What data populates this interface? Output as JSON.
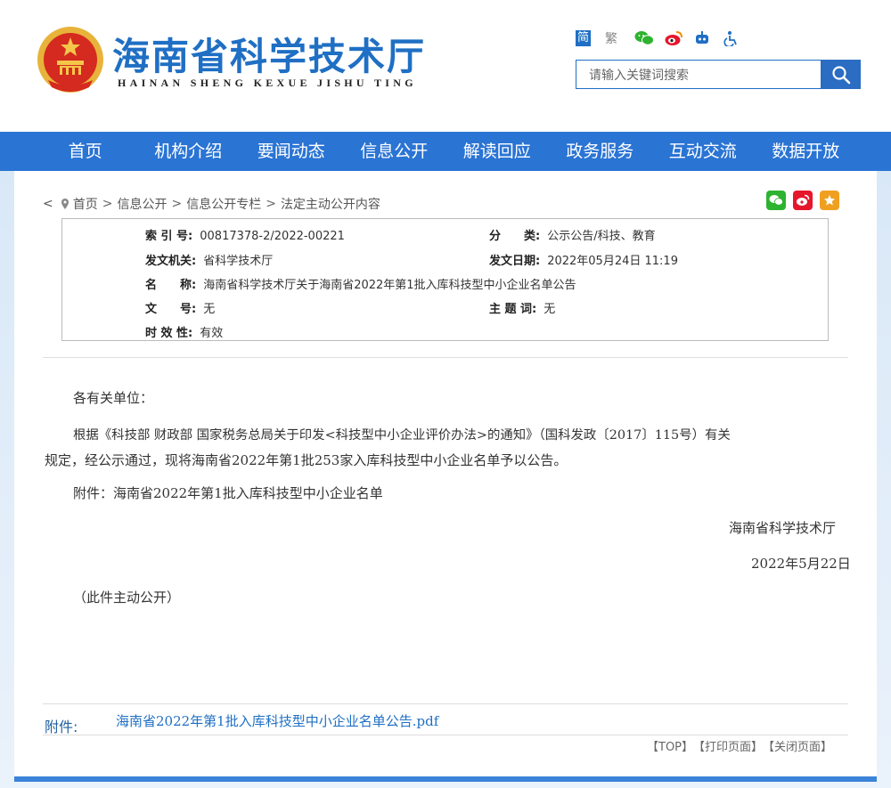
{
  "site": {
    "title": "海南省科学技术厅",
    "pinyin": "HAINAN SHENG KEXUE JISHU TING"
  },
  "tools": {
    "simplified": "简",
    "traditional": "繁"
  },
  "search": {
    "placeholder": "请输入关键词搜索"
  },
  "nav": [
    {
      "label": "首页"
    },
    {
      "label": "机构介绍"
    },
    {
      "label": "要闻动态"
    },
    {
      "label": "信息公开"
    },
    {
      "label": "解读回应"
    },
    {
      "label": "政务服务"
    },
    {
      "label": "互动交流"
    },
    {
      "label": "数据开放"
    }
  ],
  "breadcrumb": {
    "back": "<",
    "items": [
      "首页",
      "信息公开",
      "信息公开专栏",
      "法定主动公开内容"
    ],
    "sep": ">"
  },
  "info": {
    "index_label": "索 引 号:",
    "index_value": "00817378-2/2022-00221",
    "category_label": "分　　类:",
    "category_value": "公示公告/科技、教育",
    "issuer_label": "发文机关:",
    "issuer_value": "省科学技术厅",
    "date_label": "发文日期:",
    "date_value": "2022年05月24日 11:19",
    "name_label": "名　　称:",
    "name_value": "海南省科学技术厅关于海南省2022年第1批入库科技型中小企业名单公告",
    "docno_label": "文　　号:",
    "docno_value": "无",
    "subject_label": "主 题 词:",
    "subject_value": "无",
    "validity_label": "时 效 性:",
    "validity_value": "有效"
  },
  "article": {
    "salutation": "各有关单位：",
    "body_line1": "根据《科技部 财政部 国家税务总局关于印发<科技型中小企业评价办法>的通知》（国科发政〔2017〕115号）有关",
    "body_line2": "规定，经公示通过，现将海南省2022年第1批253家入库科技型中小企业名单予以公告。",
    "attachment_note": "附件：海南省2022年第1批入库科技型中小企业名单",
    "signer": "海南省科学技术厅",
    "sign_date": "2022年5月22日",
    "disclosure": "（此件主动公开）"
  },
  "attachments": {
    "label": "附件:",
    "file": "海南省2022年第1批入库科技型中小企业名单公告.pdf"
  },
  "bottom_links": [
    "【TOP】",
    "【打印页面】",
    "【关闭页面】"
  ],
  "colors": {
    "brand_blue": "#2a74d4",
    "title_blue": "#1f6fc4"
  }
}
